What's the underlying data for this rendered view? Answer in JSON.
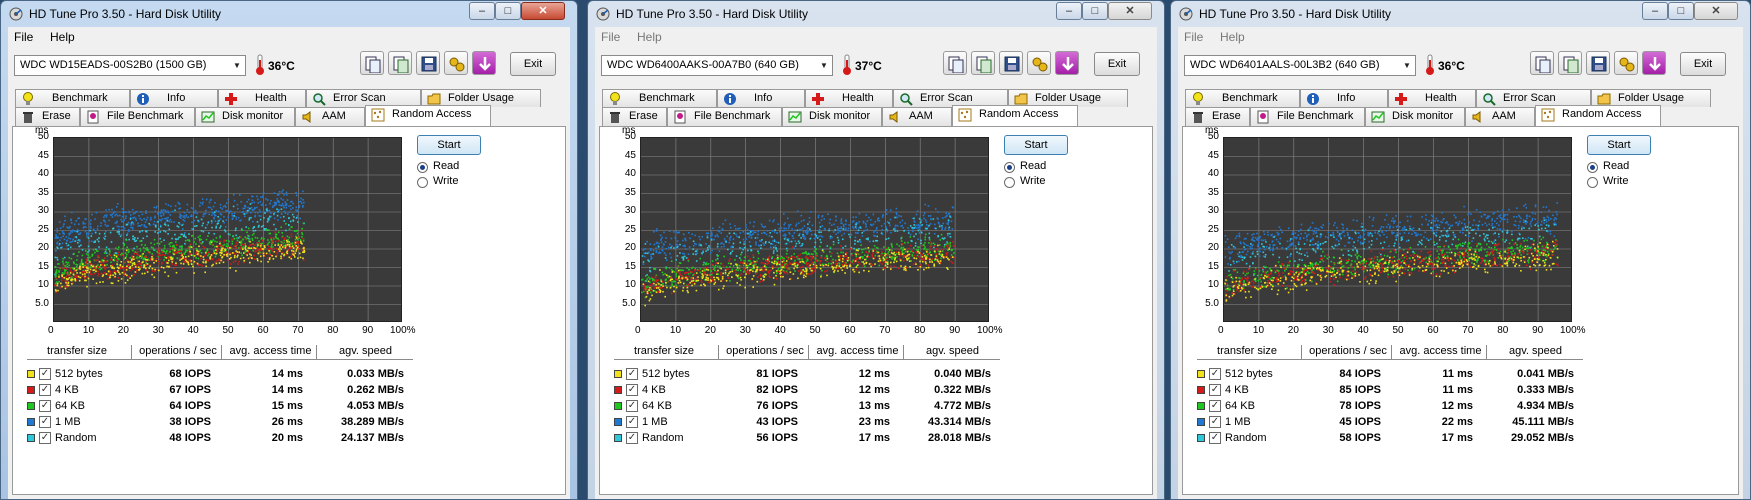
{
  "menu": {
    "file": "File",
    "help": "Help"
  },
  "toolbar": {
    "exit_label": "Exit"
  },
  "tabs": {
    "row1": [
      "Benchmark",
      "Info",
      "Health",
      "Error Scan",
      "Folder Usage"
    ],
    "row2": [
      "Erase",
      "File Benchmark",
      "Disk monitor",
      "AAM",
      "Random Access"
    ]
  },
  "controls": {
    "start": "Start",
    "read": "Read",
    "write": "Write",
    "selected_mode": "Read"
  },
  "graph": {
    "y_unit": "ms",
    "y_ticks": [
      "50",
      "45",
      "40",
      "35",
      "30",
      "25",
      "20",
      "15",
      "10",
      "5.0"
    ],
    "x_ticks": [
      "0",
      "10",
      "20",
      "30",
      "40",
      "50",
      "60",
      "70",
      "80",
      "90",
      "100%"
    ]
  },
  "table_headers": [
    "transfer size",
    "operations / sec",
    "avg. access time",
    "agv. speed"
  ],
  "colors": {
    "512 bytes": "#f2e21a",
    "4 KB": "#d61a1a",
    "64 KB": "#1ec81e",
    "1 MB": "#1f78d1",
    "Random": "#2fc8d8"
  },
  "windows": [
    {
      "title": "HD Tune Pro 3.50 - Hard Disk Utility",
      "active": true,
      "drive": "WDC WD15EADS-00S2B0 (1500 GB)",
      "temperature": "36°C",
      "rows": [
        {
          "size": "512 bytes",
          "ops": "68 IOPS",
          "access": "14 ms",
          "speed": "0.033 MB/s"
        },
        {
          "size": "4 KB",
          "ops": "67 IOPS",
          "access": "14 ms",
          "speed": "0.262 MB/s"
        },
        {
          "size": "64 KB",
          "ops": "64 IOPS",
          "access": "15 ms",
          "speed": "4.053 MB/s"
        },
        {
          "size": "1 MB",
          "ops": "38 IOPS",
          "access": "26 ms",
          "speed": "38.289 MB/s"
        },
        {
          "size": "Random",
          "ops": "48 IOPS",
          "access": "20 ms",
          "speed": "24.137 MB/s"
        }
      ]
    },
    {
      "title": "HD Tune Pro 3.50 - Hard Disk Utility",
      "active": false,
      "drive": "WDC WD6400AAKS-00A7B0 (640 GB)",
      "temperature": "37°C",
      "rows": [
        {
          "size": "512 bytes",
          "ops": "81 IOPS",
          "access": "12 ms",
          "speed": "0.040 MB/s"
        },
        {
          "size": "4 KB",
          "ops": "82 IOPS",
          "access": "12 ms",
          "speed": "0.322 MB/s"
        },
        {
          "size": "64 KB",
          "ops": "76 IOPS",
          "access": "13 ms",
          "speed": "4.772 MB/s"
        },
        {
          "size": "1 MB",
          "ops": "43 IOPS",
          "access": "23 ms",
          "speed": "43.314 MB/s"
        },
        {
          "size": "Random",
          "ops": "56 IOPS",
          "access": "17 ms",
          "speed": "28.018 MB/s"
        }
      ]
    },
    {
      "title": "HD Tune Pro 3.50 - Hard Disk Utility",
      "active": false,
      "drive": "WDC WD6401AALS-00L3B2 (640 GB)",
      "temperature": "36°C",
      "rows": [
        {
          "size": "512 bytes",
          "ops": "84 IOPS",
          "access": "11 ms",
          "speed": "0.041 MB/s"
        },
        {
          "size": "4 KB",
          "ops": "85 IOPS",
          "access": "11 ms",
          "speed": "0.333 MB/s"
        },
        {
          "size": "64 KB",
          "ops": "78 IOPS",
          "access": "12 ms",
          "speed": "4.934 MB/s"
        },
        {
          "size": "1 MB",
          "ops": "45 IOPS",
          "access": "22 ms",
          "speed": "45.111 MB/s"
        },
        {
          "size": "Random",
          "ops": "58 IOPS",
          "access": "17 ms",
          "speed": "29.052 MB/s"
        }
      ]
    }
  ]
}
